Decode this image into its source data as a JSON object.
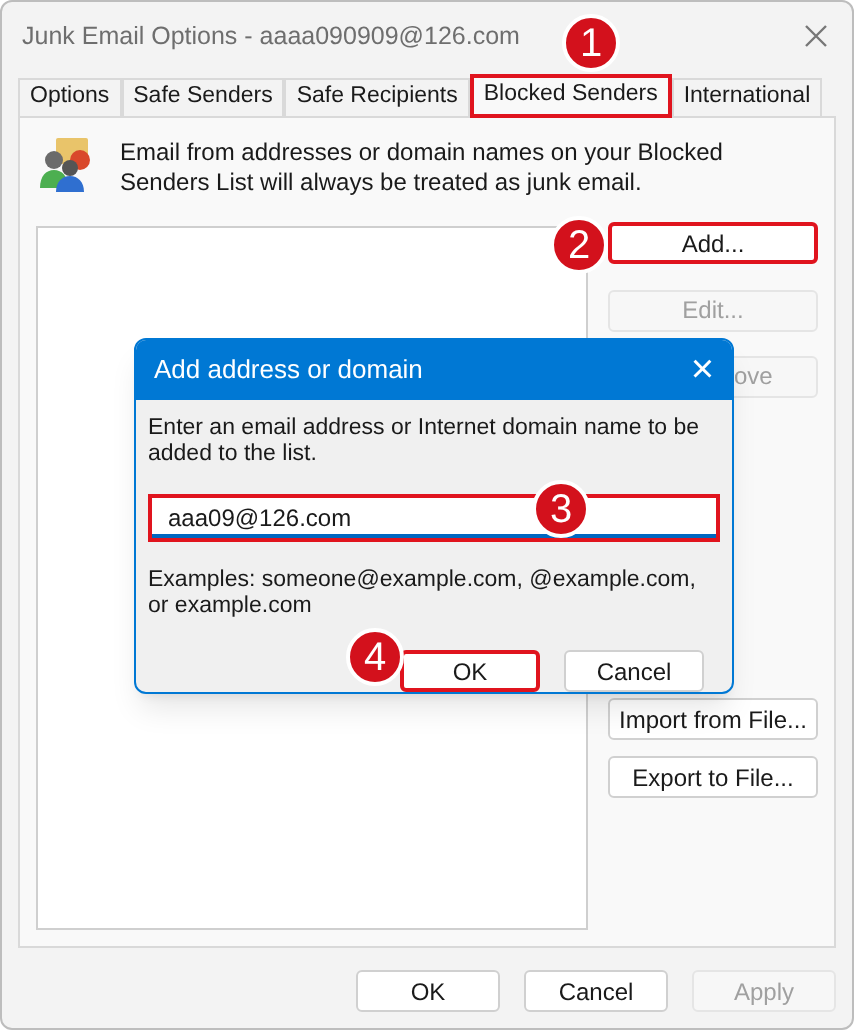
{
  "window": {
    "title": "Junk Email Options - aaaa090909@126.com"
  },
  "tabs": [
    {
      "label": "Options",
      "selected": false,
      "highlighted": false
    },
    {
      "label": "Safe Senders",
      "selected": false,
      "highlighted": false
    },
    {
      "label": "Safe Recipients",
      "selected": false,
      "highlighted": false
    },
    {
      "label": "Blocked Senders",
      "selected": true,
      "highlighted": true
    },
    {
      "label": "International",
      "selected": false,
      "highlighted": false
    }
  ],
  "description": "Email from addresses or domain names on your Blocked Senders List will always be treated as junk email.",
  "side_buttons_top": [
    {
      "label": "Add...",
      "disabled": false,
      "highlighted": true
    },
    {
      "label": "Edit...",
      "disabled": true,
      "highlighted": false
    },
    {
      "label": "ove",
      "disabled": true,
      "highlighted": false
    }
  ],
  "side_buttons_bottom": [
    {
      "label": "Import from File...",
      "disabled": false,
      "highlighted": false
    },
    {
      "label": "Export to File...",
      "disabled": false,
      "highlighted": false
    }
  ],
  "dialog": {
    "title": "Add address or domain",
    "close": "×",
    "prompt": "Enter an email address or Internet domain name to be added to the list.",
    "input": {
      "value": "aaa09@126.com",
      "highlighted": true
    },
    "examples": "Examples: someone@example.com, @example.com, or example.com",
    "buttons": [
      {
        "label": "OK",
        "highlighted": true
      },
      {
        "label": "Cancel",
        "highlighted": false
      }
    ]
  },
  "footer_buttons": [
    {
      "label": "OK",
      "disabled": false
    },
    {
      "label": "Cancel",
      "disabled": false
    },
    {
      "label": "Apply",
      "disabled": true
    }
  ],
  "markers": [
    "1",
    "2",
    "3",
    "4"
  ]
}
